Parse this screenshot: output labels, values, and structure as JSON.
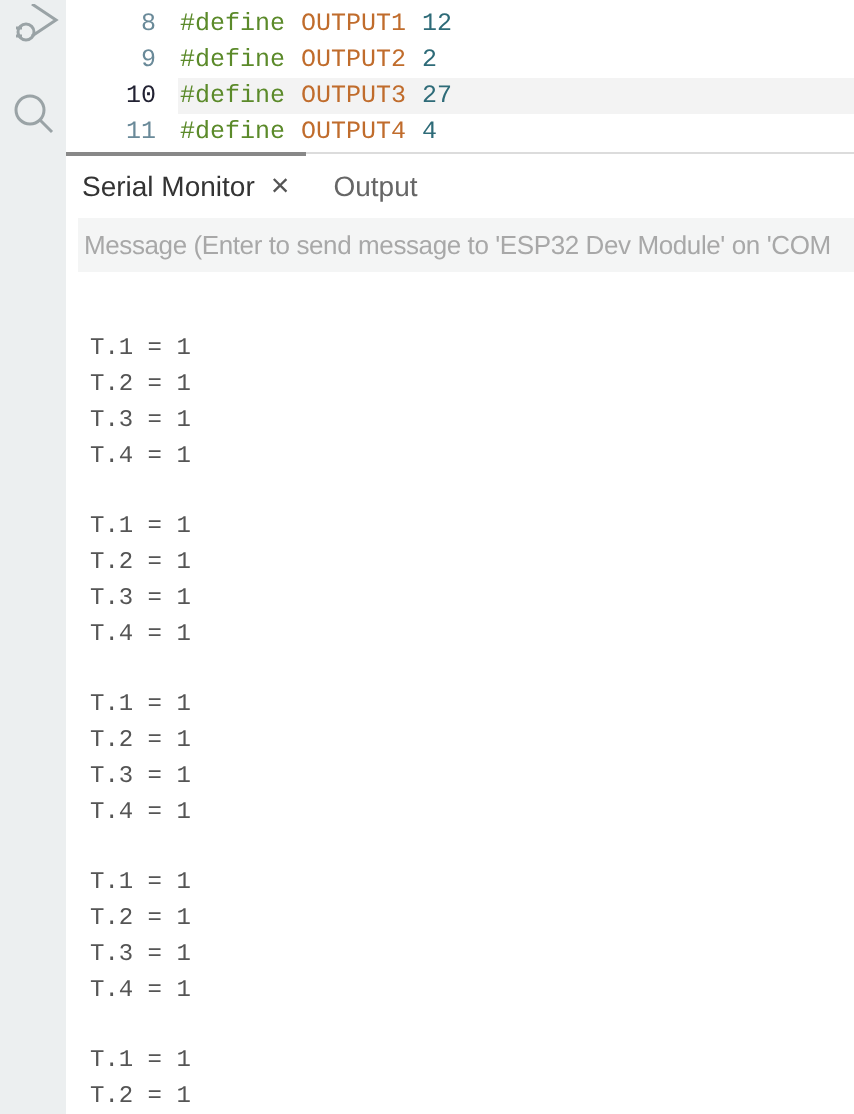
{
  "editor": {
    "lines": [
      {
        "number": "8",
        "selected": false,
        "tokens": [
          {
            "kind": "keyword",
            "text": "#define"
          },
          {
            "kind": "macro",
            "text": "OUTPUT1"
          },
          {
            "kind": "number",
            "text": "12"
          }
        ]
      },
      {
        "number": "9",
        "selected": false,
        "tokens": [
          {
            "kind": "keyword",
            "text": "#define"
          },
          {
            "kind": "macro",
            "text": "OUTPUT2"
          },
          {
            "kind": "number",
            "text": "2"
          }
        ]
      },
      {
        "number": "10",
        "selected": true,
        "tokens": [
          {
            "kind": "keyword",
            "text": "#define"
          },
          {
            "kind": "macro",
            "text": "OUTPUT3"
          },
          {
            "kind": "number",
            "text": "27"
          }
        ]
      },
      {
        "number": "11",
        "selected": false,
        "tokens": [
          {
            "kind": "keyword",
            "text": "#define"
          },
          {
            "kind": "macro",
            "text": "OUTPUT4"
          },
          {
            "kind": "number",
            "text": "4"
          }
        ]
      }
    ]
  },
  "panel": {
    "tabs": [
      {
        "label": "Serial Monitor",
        "selected": true,
        "close": "×"
      },
      {
        "label": "Output",
        "selected": false
      }
    ],
    "message_field": {
      "placeholder": "Message (Enter to send message to 'ESP32 Dev Module' on 'COM"
    },
    "output_blocks": [
      [
        "T.1 = 1",
        "T.2 = 1",
        "T.3 = 1",
        "T.4 = 1"
      ],
      [
        "T.1 = 1",
        "T.2 = 1",
        "T.3 = 1",
        "T.4 = 1"
      ],
      [
        "T.1 = 1",
        "T.2 = 1",
        "T.3 = 1",
        "T.4 = 1"
      ],
      [
        "T.1 = 1",
        "T.2 = 1",
        "T.3 = 1",
        "T.4 = 1"
      ],
      [
        "T.1 = 1",
        "T.2 = 1"
      ]
    ]
  }
}
